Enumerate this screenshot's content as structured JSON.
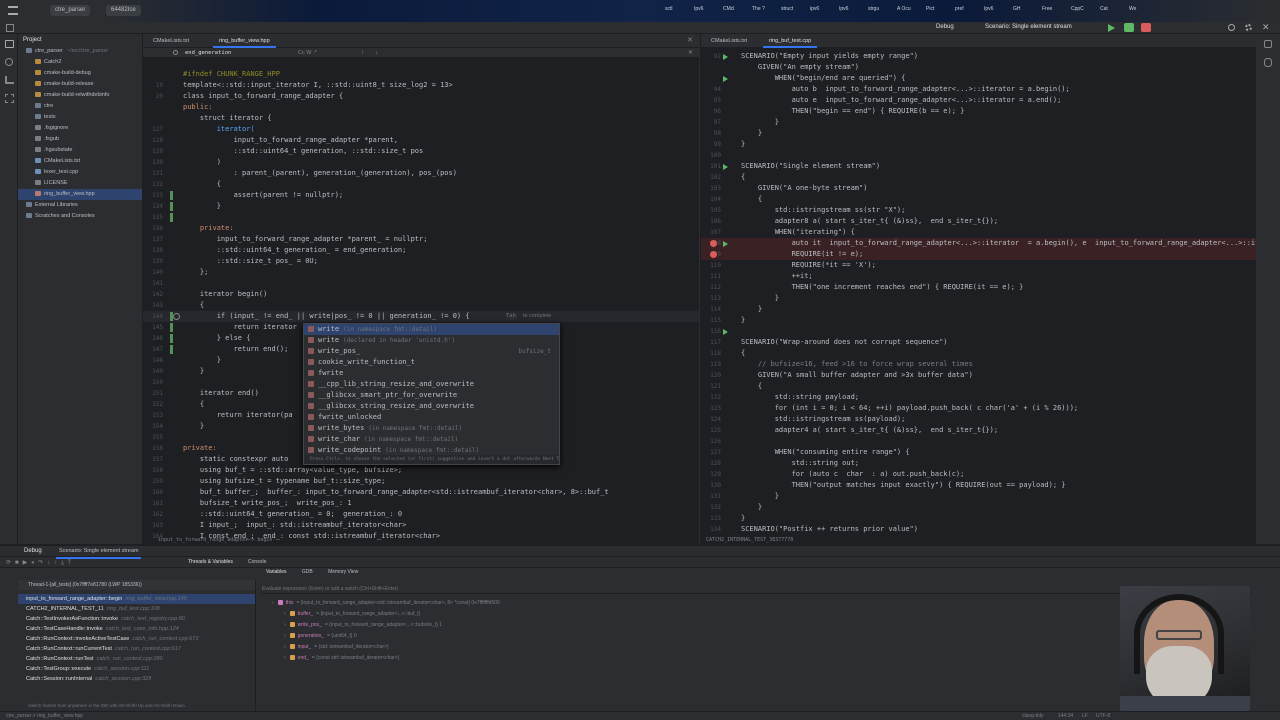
{
  "topbar": {
    "chips": [
      "ctre_parser",
      "64482Ice"
    ],
    "browser_tabs": [
      "sctl",
      "Ipv6",
      "CMcl",
      "The ?",
      "struct",
      "ipv6",
      "Ipv6",
      "strgu",
      "A Ocu",
      "Pict",
      "pref",
      "Ipv6",
      "GH",
      "Free",
      "CppC",
      "Cat",
      "We"
    ],
    "run_config": "Scenario: Single element stream",
    "debug_label": "Debug"
  },
  "project": {
    "title": "Project",
    "items": [
      {
        "label": "ctre_parser",
        "meta": "~/src/ctre_parser",
        "indent": 0,
        "color": "#6e7b8f"
      },
      {
        "label": "Catch2",
        "indent": 1,
        "color": "#b88a3d"
      },
      {
        "label": "cmake-build-debug",
        "indent": 1,
        "color": "#b88a3d"
      },
      {
        "label": "cmake-build-release",
        "indent": 1,
        "color": "#b88a3d"
      },
      {
        "label": "cmake-build-relwithdebinfo",
        "indent": 1,
        "color": "#b88a3d"
      },
      {
        "label": "ctre",
        "indent": 1,
        "color": "#6e7b8f"
      },
      {
        "label": "tests",
        "indent": 1,
        "color": "#6e7b8f"
      },
      {
        "label": ".fsgignore",
        "indent": 1,
        "color": "#7a7e85"
      },
      {
        "label": ".fsgub",
        "indent": 1,
        "color": "#7a7e85"
      },
      {
        "label": ".hgsubstate",
        "indent": 1,
        "color": "#7a7e85"
      },
      {
        "label": "CMakeLists.txt",
        "indent": 1,
        "color": "#6e8fb8"
      },
      {
        "label": "lexer_test.cpp",
        "indent": 1,
        "color": "#6e8fb8"
      },
      {
        "label": "LICENSE",
        "indent": 1,
        "color": "#7a7e85"
      },
      {
        "label": "ring_buffer_view.hpp",
        "indent": 1,
        "color": "#b87a6e",
        "selected": true
      },
      {
        "label": "External Libraries",
        "indent": 0,
        "color": "#6e7b8f"
      },
      {
        "label": "Scratches and Consoles",
        "indent": 0,
        "color": "#6e7b8f"
      }
    ]
  },
  "editor1": {
    "tabs": [
      "CMakeLists.txt",
      "ring_buffer_view.hpp"
    ],
    "find_text": "end_generation",
    "breadcrumb": "input_to_forward_range_adapter  >  begin",
    "lines": [
      {
        "n": "",
        "t": "#ifndef CHUNK_RANGE_HPP",
        "c": "mac"
      },
      {
        "n": "19",
        "t": "template<::std::input_iterator I, ::std::uint8_t size_log2 = 13>",
        "c": ""
      },
      {
        "n": "20",
        "t": "class input_to_forward_range_adapter {",
        "c": ""
      },
      {
        "n": "",
        "t": "public:",
        "c": "kw"
      },
      {
        "n": "",
        "t": "    struct iterator {",
        "c": ""
      },
      {
        "n": "127",
        "t": "        iterator(",
        "c": "fn"
      },
      {
        "n": "128",
        "t": "            input_to_forward_range_adapter *parent,",
        "c": ""
      },
      {
        "n": "129",
        "t": "            ::std::uint64_t generation, ::std::size_t pos",
        "c": ""
      },
      {
        "n": "130",
        "t": "        )",
        "c": ""
      },
      {
        "n": "131",
        "t": "            : parent_(parent), generation_(generation), pos_(pos)",
        "c": ""
      },
      {
        "n": "132",
        "t": "        {",
        "c": ""
      },
      {
        "n": "133",
        "t": "            assert(parent != nullptr);",
        "c": ""
      },
      {
        "n": "134",
        "t": "        }",
        "c": ""
      },
      {
        "n": "135",
        "t": "",
        "c": ""
      },
      {
        "n": "136",
        "t": "    private:",
        "c": "kw"
      },
      {
        "n": "137",
        "t": "        input_to_forward_range_adapter *parent_ = nullptr;",
        "c": ""
      },
      {
        "n": "138",
        "t": "        ::std::uint64_t generation_ = end_generation;",
        "c": ""
      },
      {
        "n": "139",
        "t": "        ::std::size_t pos_ = 0U;",
        "c": ""
      },
      {
        "n": "140",
        "t": "    };",
        "c": ""
      },
      {
        "n": "141",
        "t": "",
        "c": ""
      },
      {
        "n": "142",
        "t": "    iterator begin()",
        "c": ""
      },
      {
        "n": "143",
        "t": "    {",
        "c": ""
      },
      {
        "n": "144",
        "t": "        if (input_ != end_ || write|pos_ != 0 || generation_ != 0) {",
        "c": "",
        "active": true
      },
      {
        "n": "145",
        "t": "            return iterator",
        "c": ""
      },
      {
        "n": "146",
        "t": "        } else {",
        "c": ""
      },
      {
        "n": "147",
        "t": "            return end();",
        "c": ""
      },
      {
        "n": "148",
        "t": "        }",
        "c": ""
      },
      {
        "n": "149",
        "t": "    }",
        "c": ""
      },
      {
        "n": "150",
        "t": "",
        "c": ""
      },
      {
        "n": "151",
        "t": "    iterator end()",
        "c": ""
      },
      {
        "n": "152",
        "t": "    {",
        "c": ""
      },
      {
        "n": "153",
        "t": "        return iterator(pa",
        "c": ""
      },
      {
        "n": "154",
        "t": "    }",
        "c": ""
      },
      {
        "n": "155",
        "t": "",
        "c": ""
      },
      {
        "n": "156",
        "t": "private:",
        "c": "kw"
      },
      {
        "n": "157",
        "t": "    static constexpr auto",
        "c": ""
      },
      {
        "n": "158",
        "t": "    using buf_t = ::std::array<value_type, bufsize>;",
        "c": ""
      },
      {
        "n": "159",
        "t": "    using bufsize_t = typename buf_t::size_type;",
        "c": ""
      },
      {
        "n": "160",
        "t": "    buf_t buffer_;  buffer_: input_to_forward_range_adapter<std::istreambuf_iterator<char>, 8>::buf_t",
        "c": ""
      },
      {
        "n": "161",
        "t": "    bufsize_t write_pos_;  write_pos_: 1",
        "c": ""
      },
      {
        "n": "162",
        "t": "    ::std::uint64_t generation_ = 0;  generation_: 0",
        "c": ""
      },
      {
        "n": "163",
        "t": "    I input_;  input_: std::istreambuf_iterator<char>",
        "c": ""
      },
      {
        "n": "164",
        "t": "    I const end_;  end_: const std::istreambuf_iterator<char>",
        "c": ""
      }
    ],
    "tab_hint": "Tab",
    "tab_hint_text": "to complete"
  },
  "completion": {
    "items": [
      {
        "name": "write",
        "detail": "(in namespace fmt::detail)",
        "right": ""
      },
      {
        "name": "write",
        "detail": "(declared in header 'unistd.h')",
        "right": ""
      },
      {
        "name": "write_pos_",
        "detail": "",
        "right": "bufsize_t"
      },
      {
        "name": "cookie_write_function_t",
        "detail": "",
        "right": ""
      },
      {
        "name": "fwrite",
        "detail": "",
        "right": ""
      },
      {
        "name": "__cpp_lib_string_resize_and_overwrite",
        "detail": "",
        "right": ""
      },
      {
        "name": "__glibcxx_smart_ptr_for_overwrite",
        "detail": "",
        "right": ""
      },
      {
        "name": "__glibcxx_string_resize_and_overwrite",
        "detail": "",
        "right": ""
      },
      {
        "name": "fwrite_unlocked",
        "detail": "",
        "right": ""
      },
      {
        "name": "write_bytes",
        "detail": "(in namespace fmt::detail)",
        "right": ""
      },
      {
        "name": "write_char",
        "detail": "(in namespace fmt::detail)",
        "right": ""
      },
      {
        "name": "write_codepoint",
        "detail": "(in namespace fmt::detail)",
        "right": ""
      }
    ],
    "footer": "Press Ctrl+. to choose the selected (or first) suggestion and insert a dot afterwards  Next Tip"
  },
  "editor2": {
    "tabs": [
      "CMakeLists.txt",
      "ring_buf_test.cpp"
    ],
    "breadcrumb": "CATCH2_INTERNAL_TEST_38377778",
    "lines": [
      {
        "n": "92",
        "t": "SCENARIO(\"Empty input yields empty range\")",
        "c": ""
      },
      {
        "n": "",
        "t": "    GIVEN(\"An empty stream\")",
        "c": ""
      },
      {
        "n": "",
        "t": "        WHEN(\"begin/end are queried\") {",
        "c": ""
      },
      {
        "n": "94",
        "t": "            auto b  input_to_forward_range_adapter<...>::iterator = a.begin();",
        "c": ""
      },
      {
        "n": "95",
        "t": "            auto e  input_to_forward_range_adapter<...>::iterator = a.end();",
        "c": ""
      },
      {
        "n": "96",
        "t": "            THEN(\"begin == end\") { REQUIRE(b == e); }",
        "c": ""
      },
      {
        "n": "97",
        "t": "        }",
        "c": ""
      },
      {
        "n": "98",
        "t": "    }",
        "c": ""
      },
      {
        "n": "99",
        "t": "}",
        "c": ""
      },
      {
        "n": "100",
        "t": "",
        "c": ""
      },
      {
        "n": "101",
        "t": "SCENARIO(\"Single element stream\")",
        "c": ""
      },
      {
        "n": "102",
        "t": "{",
        "c": ""
      },
      {
        "n": "103",
        "t": "    GIVEN(\"A one-byte stream\")",
        "c": ""
      },
      {
        "n": "104",
        "t": "    {",
        "c": ""
      },
      {
        "n": "105",
        "t": "        std::istringstream ss(str \"X\");",
        "c": ""
      },
      {
        "n": "106",
        "t": "        adapter8 a( start s_iter_t{ (&)ss},  end s_iter_t{});",
        "c": ""
      },
      {
        "n": "107",
        "t": "        WHEN(\"iterating\") {",
        "c": ""
      },
      {
        "n": "108",
        "t": "            auto it  input_to_forward_range_adapter<...>::iterator  = a.begin(), e  input_to_forward_range_adapter<...>::iterator = a.e",
        "c": "",
        "bp": true
      },
      {
        "n": "109",
        "t": "            REQUIRE(it != e);",
        "c": "",
        "bp": true
      },
      {
        "n": "110",
        "t": "            REQUIRE(*it == 'X');",
        "c": ""
      },
      {
        "n": "111",
        "t": "            ++it;",
        "c": ""
      },
      {
        "n": "112",
        "t": "            THEN(\"one increment reaches end\") { REQUIRE(it == e); }",
        "c": ""
      },
      {
        "n": "113",
        "t": "        }",
        "c": ""
      },
      {
        "n": "114",
        "t": "    }",
        "c": ""
      },
      {
        "n": "115",
        "t": "}",
        "c": ""
      },
      {
        "n": "116",
        "t": "",
        "c": ""
      },
      {
        "n": "117",
        "t": "SCENARIO(\"Wrap-around does not corrupt sequence\")",
        "c": ""
      },
      {
        "n": "118",
        "t": "{",
        "c": ""
      },
      {
        "n": "119",
        "t": "    // bufsize=16, feed >16 to force wrap several times",
        "c": "cm"
      },
      {
        "n": "120",
        "t": "    GIVEN(\"A small buffer adapter and >3x buffer data\")",
        "c": ""
      },
      {
        "n": "121",
        "t": "    {",
        "c": ""
      },
      {
        "n": "122",
        "t": "        std::string payload;",
        "c": ""
      },
      {
        "n": "123",
        "t": "        for (int i = 0; i < 64; ++i) payload.push_back( c char('a' + (i % 26)));",
        "c": ""
      },
      {
        "n": "124",
        "t": "        std::istringstream ss(payload);",
        "c": ""
      },
      {
        "n": "125",
        "t": "        adapter4 a( start s_iter_t{ (&)ss},  end s_iter_t{});",
        "c": ""
      },
      {
        "n": "126",
        "t": "",
        "c": ""
      },
      {
        "n": "127",
        "t": "        WHEN(\"consuming entire range\") {",
        "c": ""
      },
      {
        "n": "128",
        "t": "            std::string out;",
        "c": ""
      },
      {
        "n": "129",
        "t": "            for (auto c  char  : a) out.push_back(c);",
        "c": ""
      },
      {
        "n": "130",
        "t": "            THEN(\"output matches input exactly\") { REQUIRE(out == payload); }",
        "c": ""
      },
      {
        "n": "131",
        "t": "        }",
        "c": ""
      },
      {
        "n": "132",
        "t": "    }",
        "c": ""
      },
      {
        "n": "133",
        "t": "}",
        "c": ""
      },
      {
        "n": "134",
        "t": "SCENARIO(\"Postfix ++ returns prior value\")",
        "c": ""
      }
    ]
  },
  "debug": {
    "tabs": [
      "Debug",
      "Scenario: Single element stream"
    ],
    "subtabs": [
      "Threads & Variables",
      "Console"
    ],
    "thread": "Thread-1-[all_tests] (0x7ffff7e81780 (LWP 185336))",
    "var_tabs": [
      "Variables",
      "GDB",
      "Memory View"
    ],
    "eval_placeholder": "Evaluate expression (Enter) or add a watch (Ctrl+Shift+Enter)",
    "frames": [
      {
        "fn": "input_to_forward_range_adapter::begin",
        "loc": "ring_buffer_view.hpp:145"
      },
      {
        "fn": "CATCH2_INTERNAL_TEST_11",
        "loc": "ring_buf_test.cpp:108"
      },
      {
        "fn": "Catch::TestInvokerAsFunction::invoke",
        "loc": "catch_test_registry.cpp:80"
      },
      {
        "fn": "Catch::TestCaseHandle::invoke",
        "loc": "catch_test_case_info.hpp:124"
      },
      {
        "fn": "Catch::RunContext::invokeActiveTestCase",
        "loc": "catch_run_context.cpp:673"
      },
      {
        "fn": "Catch::RunContext::runCurrentTest",
        "loc": "catch_run_context.cpp:617"
      },
      {
        "fn": "Catch::RunContext::runTest",
        "loc": "catch_run_context.cpp:280"
      },
      {
        "fn": "Catch::TestGroup::execute",
        "loc": "catch_session.cpp:111"
      },
      {
        "fn": "Catch::Session::runInternal",
        "loc": "catch_session.cpp:328"
      }
    ],
    "frames_hint": "Switch frames from anywhere in the IDE with Alt+Shift+Up and Alt+Shift+Down",
    "vars": [
      {
        "name": "this",
        "val": "= {input_to_forward_range_adapter<std::istreambuf_iterator<char>, 8> *const} 0x7fffffffd500"
      },
      {
        "name": "buffer_",
        "val": "= {input_to_forward_range_adapter<...>::buf_t}"
      },
      {
        "name": "write_pos_",
        "val": "= {input_to_forward_range_adapter<...>::bufsize_t} 1"
      },
      {
        "name": "generation_",
        "val": "= {uint64_t} 0"
      },
      {
        "name": "input_",
        "val": "= {std::istreambuf_iterator<char>}"
      },
      {
        "name": "end_",
        "val": "= {const std::istreambuf_iterator<char>}"
      }
    ]
  },
  "statusbar": {
    "left": "ctre_parser  >  ring_buffer_view.hpp",
    "right": [
      "clang-tidy",
      "144:34",
      "LF",
      "UTF-8"
    ]
  },
  "colors": {
    "accent": "#3574f0",
    "breakpoint": "#db5c5c",
    "keyword": "#cf8e6d",
    "string": "#6aab73"
  }
}
